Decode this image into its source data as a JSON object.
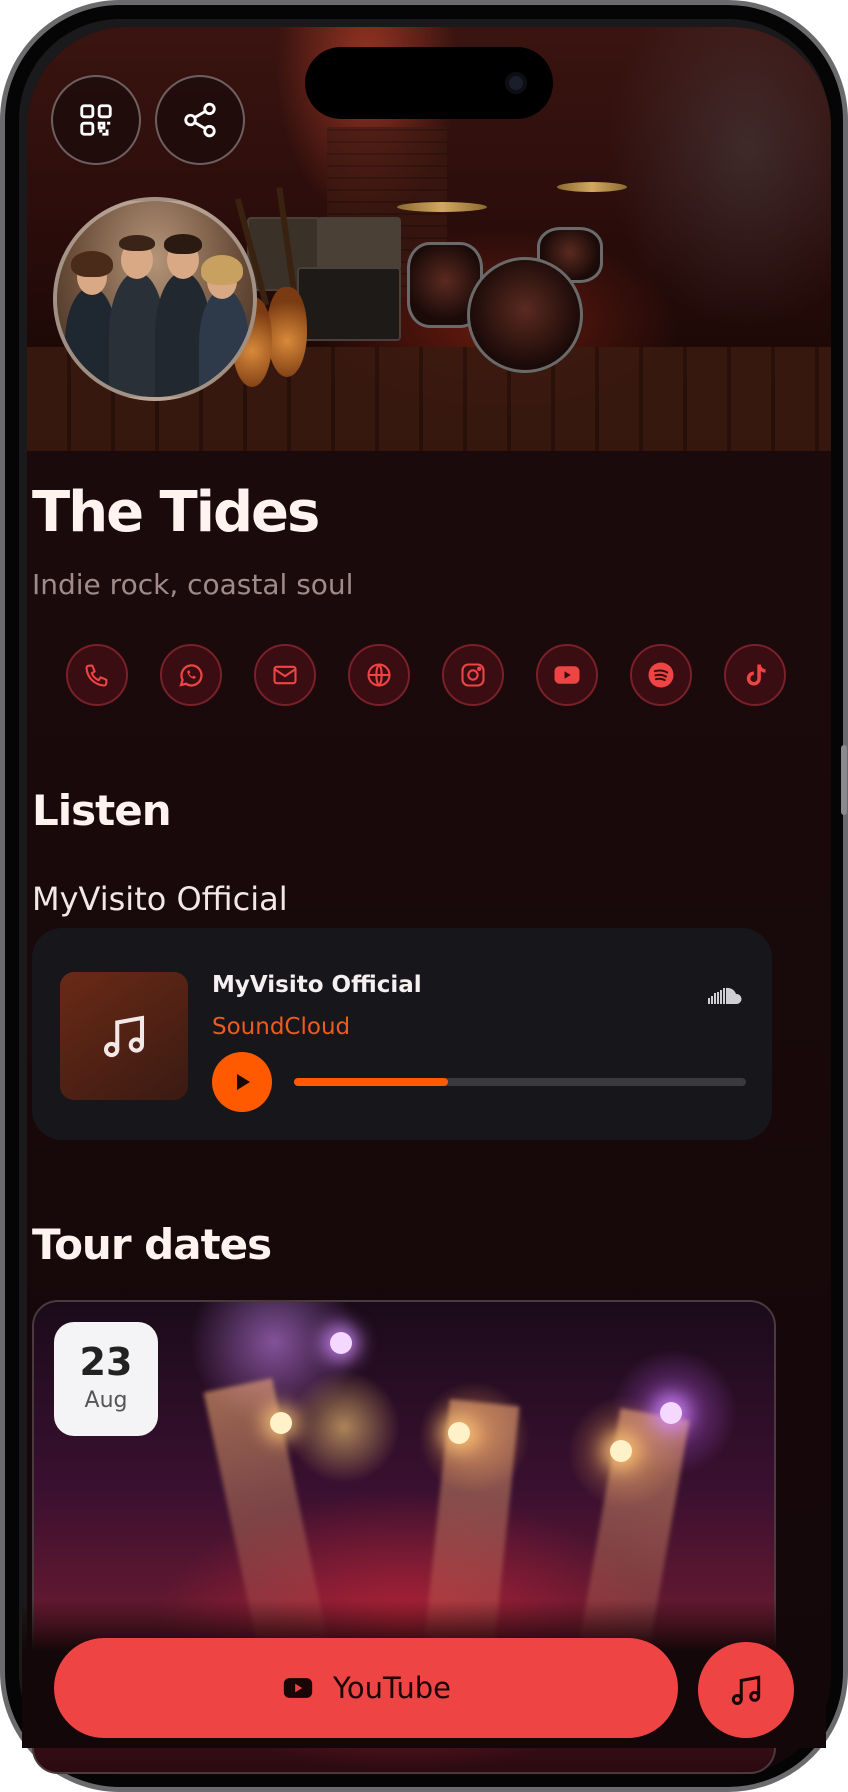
{
  "artist": {
    "name": "The Tides",
    "tagline": "Indie rock, coastal soul"
  },
  "hero_actions": {
    "qr_icon": "qr-code-icon",
    "share_icon": "share-icon"
  },
  "social_links": [
    {
      "icon": "phone-icon",
      "label": "Phone"
    },
    {
      "icon": "whatsapp-icon",
      "label": "WhatsApp"
    },
    {
      "icon": "mail-icon",
      "label": "Email"
    },
    {
      "icon": "globe-icon",
      "label": "Website"
    },
    {
      "icon": "instagram-icon",
      "label": "Instagram"
    },
    {
      "icon": "youtube-icon",
      "label": "YouTube"
    },
    {
      "icon": "spotify-icon",
      "label": "Spotify"
    },
    {
      "icon": "tiktok-icon",
      "label": "TikTok"
    }
  ],
  "listen": {
    "heading": "Listen",
    "playlist_name": "MyVisito Official",
    "player": {
      "track_title": "MyVisito Official",
      "source": "SoundCloud",
      "progress": 0.34
    }
  },
  "tour": {
    "heading": "Tour dates",
    "items": [
      {
        "day": "23",
        "month": "Aug"
      }
    ]
  },
  "cta": {
    "label": "YouTube"
  },
  "colors": {
    "accent": "#ef4444",
    "player_accent": "#ff5a00",
    "background": "#140709",
    "icon_ring": "#7a2028"
  }
}
